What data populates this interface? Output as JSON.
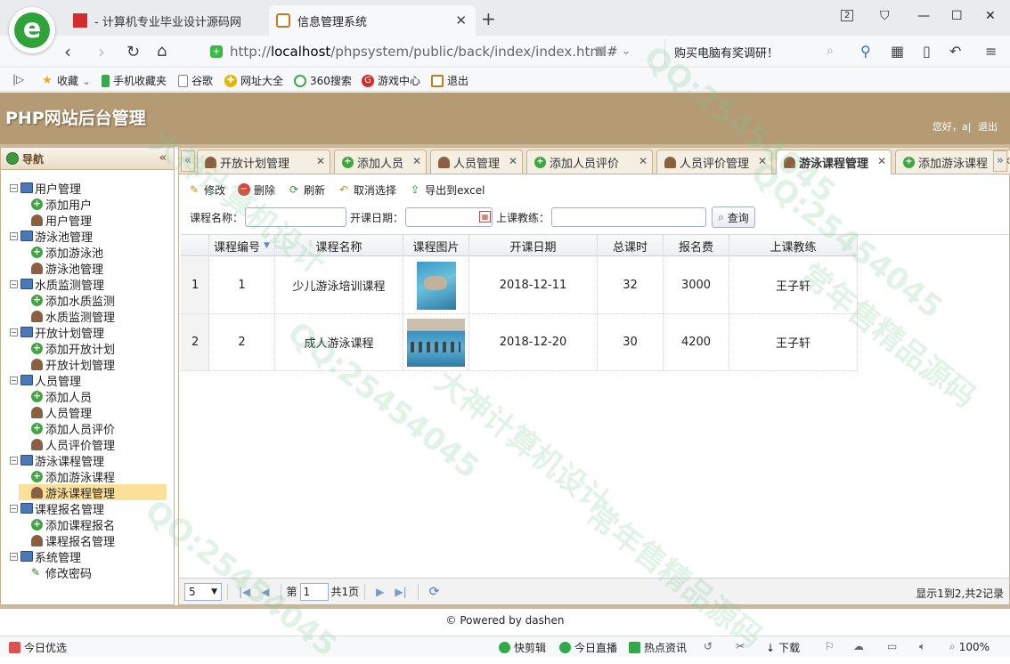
{
  "browser": {
    "tabs": [
      {
        "title": "- 计算机专业毕业设计源码网"
      },
      {
        "title": "信息管理系统"
      }
    ],
    "tab_count_badge": "2",
    "url_prefix": "http://",
    "url_host": "localhost",
    "url_path": "/phpsystem/public/back/index/index.html#",
    "search_text": "购买电脑有奖调研！",
    "favorites": [
      "收藏",
      "手机收藏夹",
      "谷歌",
      "网址大全",
      "360搜索",
      "游戏中心",
      "退出"
    ]
  },
  "app": {
    "title": "PHP网站后台管理",
    "greeting": "您好，a|",
    "logout": "退出",
    "nav_title": "导航",
    "tree": [
      {
        "label": "用户管理",
        "children": [
          "添加用户",
          "用户管理"
        ]
      },
      {
        "label": "游泳池管理",
        "children": [
          "添加游泳池",
          "游泳池管理"
        ]
      },
      {
        "label": "水质监测管理",
        "children": [
          "添加水质监测",
          "水质监测管理"
        ]
      },
      {
        "label": "开放计划管理",
        "children": [
          "添加开放计划",
          "开放计划管理"
        ]
      },
      {
        "label": "人员管理",
        "children": [
          "添加人员",
          "人员管理",
          "添加人员评价",
          "人员评价管理"
        ]
      },
      {
        "label": "游泳课程管理",
        "children": [
          "添加游泳课程",
          "游泳课程管理"
        ]
      },
      {
        "label": "课程报名管理",
        "children": [
          "添加课程报名",
          "课程报名管理"
        ]
      },
      {
        "label": "系统管理",
        "children": [
          "修改密码"
        ]
      }
    ],
    "selected_item": "游泳课程管理",
    "tabs": [
      "开放计划管理",
      "添加人员",
      "人员管理",
      "添加人员评价",
      "人员评价管理",
      "游泳课程管理",
      "添加游泳课程"
    ],
    "active_tab": "游泳课程管理",
    "toolbar": [
      "修改",
      "删除",
      "刷新",
      "取消选择",
      "导出到excel"
    ],
    "filters": {
      "course_name_label": "课程名称：",
      "start_date_label": "开课日期：",
      "coach_label": "上课教练：",
      "query_button": "查询"
    },
    "grid": {
      "columns": [
        "课程编号",
        "课程名称",
        "课程图片",
        "开课日期",
        "总课时",
        "报名费",
        "上课教练"
      ],
      "rows": [
        {
          "rownum": "1",
          "id": "1",
          "name": "少儿游泳培训课程",
          "date": "2018-12-11",
          "hours": "32",
          "fee": "3000",
          "coach": "王子轩"
        },
        {
          "rownum": "2",
          "id": "2",
          "name": "成人游泳课程",
          "date": "2018-12-20",
          "hours": "30",
          "fee": "4200",
          "coach": "王子轩"
        }
      ]
    },
    "pager": {
      "page_size": "5",
      "page_label_prefix": "第",
      "page_value": "1",
      "page_label_suffix": "共1页",
      "info": "显示1到2,共2记录"
    },
    "footer": "© Powered by dashen"
  },
  "statusbar": {
    "left": "今日优选",
    "items": [
      "快剪辑",
      "今日直播",
      "热点资讯",
      "下载"
    ],
    "zoom": "100%"
  },
  "watermarks": [
    "QQ:25454045",
    "大神计算机设计",
    "常年售精品源码",
    "QQ:25454045",
    "大神计算机设计",
    "常年售精品源码",
    "QQ:25454045",
    "QQ:25454045"
  ]
}
